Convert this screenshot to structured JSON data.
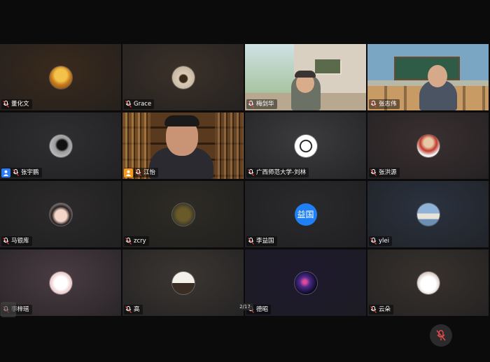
{
  "participants": [
    {
      "name": "董化文",
      "type": "avatar",
      "bg": "#3a2a1c",
      "avatar": "autumn-tree"
    },
    {
      "name": "Grace",
      "type": "avatar",
      "bg": "#3b3128",
      "avatar": "bowl"
    },
    {
      "name": "梅剑华",
      "type": "video",
      "bg": "#cfc8bd",
      "scene": "living-room"
    },
    {
      "name": "张志伟",
      "type": "video",
      "bg": "#8aa9b5",
      "scene": "classroom",
      "active": true
    },
    {
      "name": "张宇鹏",
      "type": "avatar",
      "bg": "#2f2f31",
      "avatar": "silhouette",
      "host": "blue"
    },
    {
      "name": "江怡",
      "type": "video",
      "bg": "#3a2716",
      "scene": "bookshelf",
      "host": "orange"
    },
    {
      "name": "广西师范大学-刘林",
      "type": "avatar",
      "bg": "#3c3c3f",
      "avatar": "compass"
    },
    {
      "name": "张洪源",
      "type": "avatar",
      "bg": "#3a3030",
      "avatar": "player"
    },
    {
      "name": "马银库",
      "type": "avatar",
      "bg": "#2c2a2a",
      "avatar": "girl"
    },
    {
      "name": "zcry",
      "type": "avatar",
      "bg": "#2e2b24",
      "avatar": "book"
    },
    {
      "name": "李益国",
      "type": "letter",
      "bg": "#2a2a2c",
      "letter": "益国"
    },
    {
      "name": "ylei",
      "type": "avatar",
      "bg": "#2b3340",
      "avatar": "city"
    },
    {
      "name": "李梓瑶",
      "type": "avatar",
      "bg": "#4a3c42",
      "avatar": "cat"
    },
    {
      "name": "高",
      "type": "avatar",
      "bg": "#3b3632",
      "avatar": "desk"
    },
    {
      "name": "德昭",
      "type": "avatar",
      "bg": "#1e1a2e",
      "avatar": "galaxy"
    },
    {
      "name": "云朵",
      "type": "avatar",
      "bg": "#38322d",
      "avatar": "bunny"
    }
  ],
  "pagination": "2/17",
  "icons": {
    "mic": "mic-muted-icon",
    "mute_button": "mic-off-icon",
    "host": "person-icon"
  },
  "colors": {
    "active_border": "#2fb34a",
    "host_blue": "#2b7cf7",
    "host_orange": "#f59a23",
    "letter_avatar": "#1f80f5"
  }
}
